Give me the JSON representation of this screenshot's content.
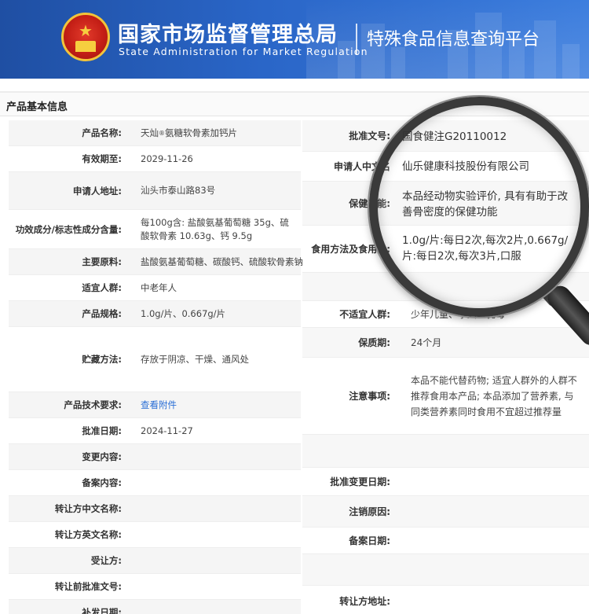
{
  "header": {
    "agency_cn": "国家市场监督管理总局",
    "agency_en": "State Administration  for  Market Regulation",
    "platform": "特殊食品信息查询平台",
    "colors": {
      "banner": "#2a66c8",
      "emblem_red": "#c41f16",
      "emblem_gold": "#f2c43a"
    }
  },
  "section": {
    "title": "产品基本信息"
  },
  "left": [
    {
      "label": "产品名称:",
      "value": "天灿®氨糖软骨素加钙片"
    },
    {
      "label": "有效期至:",
      "value": "2029-11-26"
    },
    {
      "label": "申请人地址:",
      "value": "汕头市泰山路83号"
    },
    {
      "label": "功效成分/标志性成分含量:",
      "value": "每100g含: 盐酸氨基葡萄糖 35g、硫酸软骨素 10.63g、钙 9.5g"
    },
    {
      "label": "主要原料:",
      "value": "盐酸氨基葡萄糖、碳酸钙、硫酸软骨素钠"
    },
    {
      "label": "适宜人群:",
      "value": "中老年人"
    },
    {
      "label": "产品规格:",
      "value": "1.0g/片、0.667g/片"
    },
    {
      "label": "贮藏方法:",
      "value": "存放于阴凉、干燥、通风处"
    },
    {
      "label": "产品技术要求:",
      "value": "查看附件"
    },
    {
      "label": "批准日期:",
      "value": "2024-11-27"
    },
    {
      "label": "变更内容:",
      "value": ""
    },
    {
      "label": "备案内容:",
      "value": ""
    },
    {
      "label": "转让方中文名称:",
      "value": ""
    },
    {
      "label": "转让方英文名称:",
      "value": ""
    },
    {
      "label": "受让方:",
      "value": ""
    },
    {
      "label": "转让前批准文号:",
      "value": ""
    },
    {
      "label": "补发日期:",
      "value": ""
    }
  ],
  "brand": {
    "name": "天灿",
    "mark": "®",
    "rest": "氨糖软骨素加钙片"
  },
  "right": [
    {
      "label": "批准文号:",
      "value": ""
    },
    {
      "label": "申请人中文名",
      "value": ""
    },
    {
      "label": "保健功能:",
      "value": ""
    },
    {
      "label": "食用方法及食用量:",
      "value": ""
    },
    {
      "label": "",
      "value": ""
    },
    {
      "label": "不适宜人群:",
      "value": "少年儿童、孕妇、乳母"
    },
    {
      "label": "保质期:",
      "value": "24个月"
    },
    {
      "label": "注意事项:",
      "value": "本品不能代替药物; 适宜人群外的人群不推荐食用本产品; 本品添加了营养素, 与同类营养素同时食用不宜超过推荐量"
    },
    {
      "label": "",
      "value": ""
    },
    {
      "label": "批准变更日期:",
      "value": ""
    },
    {
      "label": "注销原因:",
      "value": ""
    },
    {
      "label": "备案日期:",
      "value": ""
    },
    {
      "label": "",
      "value": ""
    },
    {
      "label": "转让方地址:",
      "value": ""
    }
  ],
  "lens": {
    "approval_no": "国食健注G20110012",
    "applicant": "仙乐健康科技股份有限公司",
    "function": "本品经动物实验评价, 具有有助于改善骨密度的保健功能",
    "dosage": "1.0g/片:每日2次,每次2片,0.667g/片:每日2次,每次3片,口服"
  }
}
